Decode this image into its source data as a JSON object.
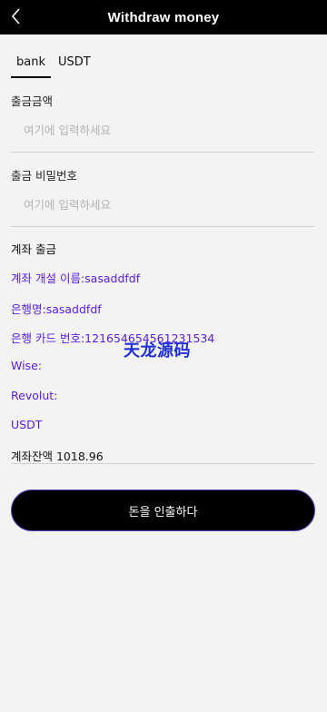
{
  "header": {
    "title": "Withdraw money",
    "back_icon": "chevron-left-icon"
  },
  "tabs": [
    {
      "label": "bank",
      "active": true
    },
    {
      "label": "USDT",
      "active": false
    }
  ],
  "form": {
    "amount_label": "출금금액",
    "amount_placeholder": "여기에 입력하세요",
    "password_label": "출금 비밀번호",
    "password_placeholder": "여기에 입력하세요"
  },
  "account": {
    "section_title": "계좌 출금",
    "lines": [
      "계좌 개설 이름:sasaddfdf",
      "은행명:sasaddfdf",
      "은행 카드 번호:121654654561231534",
      "Wise:",
      "Revolut:",
      "USDT"
    ],
    "balance": "계좌잔액 1018.96"
  },
  "watermark": "天龙源码",
  "submit_label": "돈을 인출하다",
  "colors": {
    "header_bg": "#000000",
    "accent_text": "#5a1ee0",
    "watermark": "#1f2fd6"
  }
}
